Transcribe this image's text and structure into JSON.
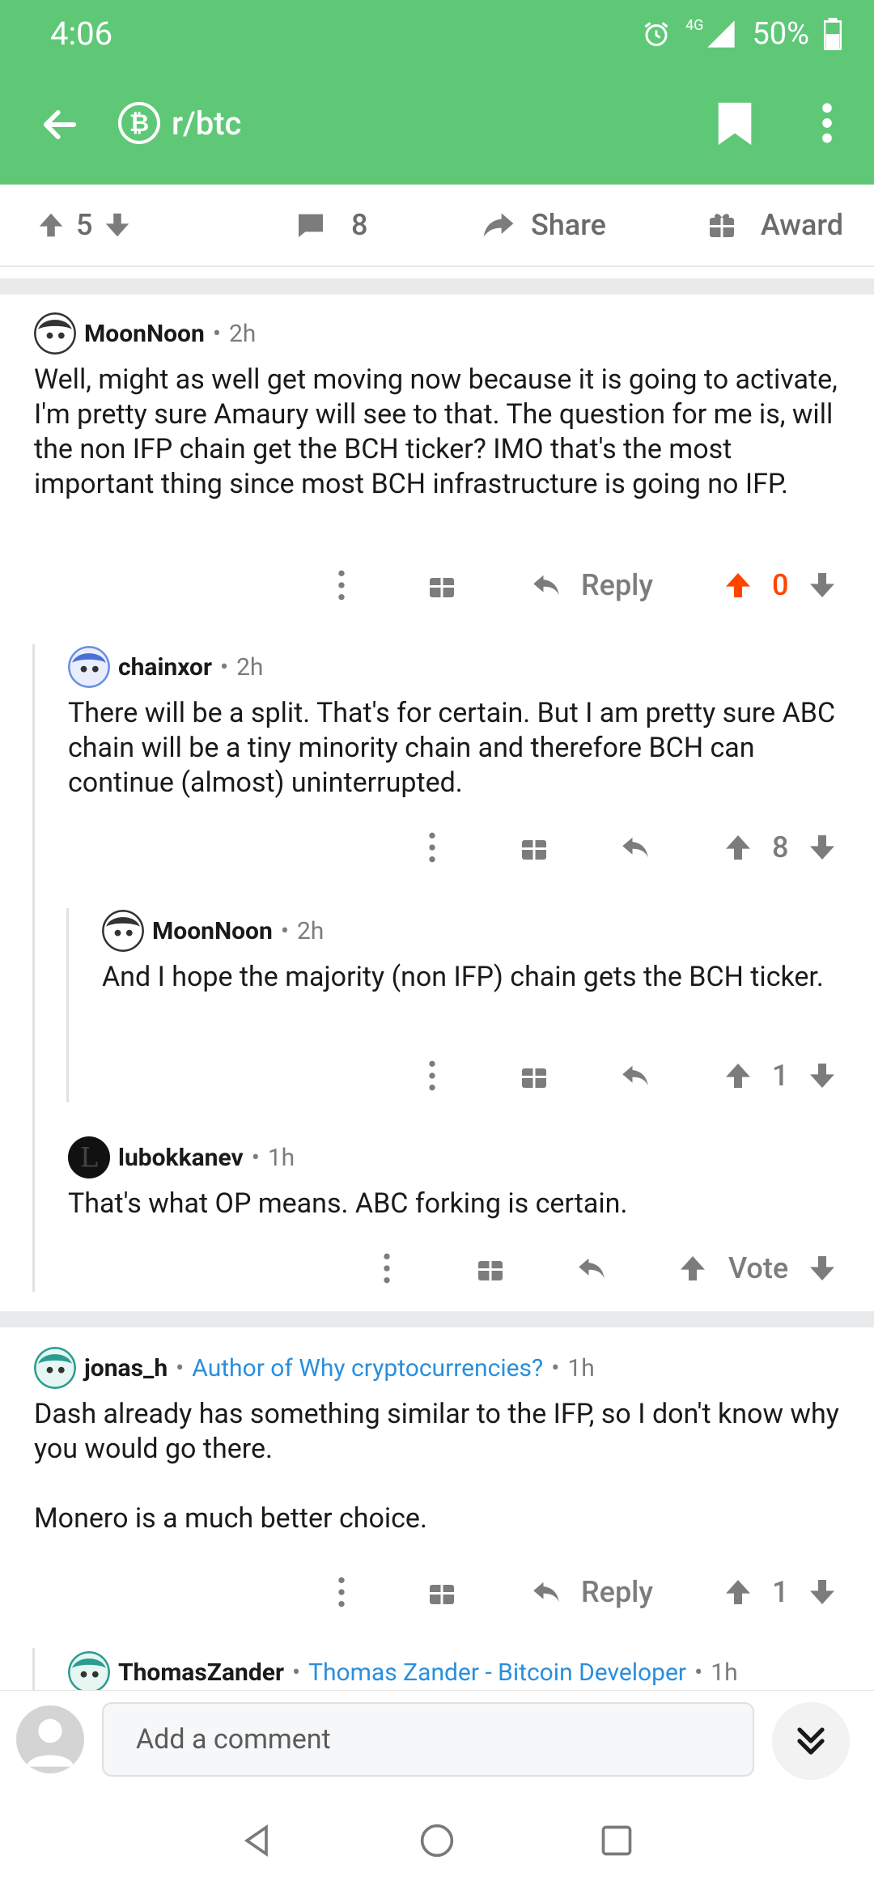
{
  "status": {
    "time": "4:06",
    "network": "4G",
    "battery": "50%"
  },
  "header": {
    "subreddit": "r/btc",
    "sub_icon_letter": "₿"
  },
  "post_actions": {
    "score": "5",
    "comments": "8",
    "share": "Share",
    "award": "Award"
  },
  "comments": [
    {
      "user": "MoonNoon",
      "time": "2h",
      "body": "Well, might as well get moving now because it is going to activate, I'm pretty sure Amaury will see to that. The question for me is, will the non IFP chain get the BCH ticker? IMO that's the most important thing since most BCH infrastructure is going no IFP.",
      "reply": "Reply",
      "score": "0"
    },
    {
      "user": "chainxor",
      "time": "2h",
      "body": "There will be a split. That's for certain. But I am pretty sure ABC chain will be a tiny minority chain and therefore BCH can continue (almost) uninterrupted.",
      "score": "8"
    },
    {
      "user": "MoonNoon",
      "time": "2h",
      "body": "And I hope the majority (non IFP) chain gets the BCH ticker.",
      "score": "1"
    },
    {
      "user": "lubokkanev",
      "time": "1h",
      "body": "That's what OP means. ABC forking is certain.",
      "score": "Vote"
    },
    {
      "user": "jonas_h",
      "flair": "Author of Why cryptocurrencies?",
      "time": "1h",
      "body": "Dash already has something similar to the IFP, so I don't know why you would go there.\n\nMonero is a much better choice.",
      "reply": "Reply",
      "score": "1"
    },
    {
      "user": "ThomasZander",
      "flair": "Thomas Zander - Bitcoin Developer",
      "time": "1h"
    }
  ],
  "comment_bar": {
    "placeholder": "Add a comment"
  },
  "colors": {
    "header_green": "#5fc877",
    "upvote_orange": "#ff4500",
    "flair_blue": "#2a8fdc"
  }
}
